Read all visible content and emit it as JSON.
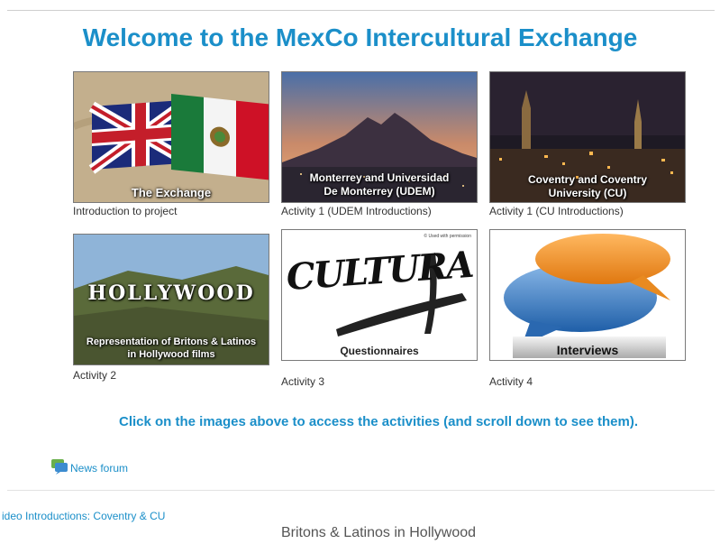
{
  "page": {
    "title": "Welcome to the MexCo Intercultural Exchange",
    "instruction": "Click on the images above to access the activities (and scroll down to see them).",
    "forum_link": "News forum",
    "video_link": "ideo Introductions: Coventry & CU",
    "section_heading": "Britons & Latinos in Hollywood"
  },
  "tiles": [
    {
      "overlay": "The Exchange",
      "caption": "Introduction to project"
    },
    {
      "overlay_line1": "Monterrey and Universidad",
      "overlay_line2": "De Monterrey (UDEM)",
      "caption": "Activity 1 (UDEM Introductions)"
    },
    {
      "overlay_line1": "Coventry and Coventry",
      "overlay_line2": "University (CU)",
      "caption": "Activity 1 (CU Introductions)"
    },
    {
      "sign": "HOLLYWOOD",
      "overlay_line1": "Representation of Britons & Latinos",
      "overlay_line2": "in Hollywood films",
      "caption": "Activity 2"
    },
    {
      "logo": "CULTURA",
      "small_note": "© Used with permission",
      "overlay": "Questionnaires",
      "caption": "Activity 3"
    },
    {
      "overlay": "Interviews",
      "caption": "Activity 4"
    }
  ],
  "colors": {
    "accent": "#1b8fc9"
  }
}
